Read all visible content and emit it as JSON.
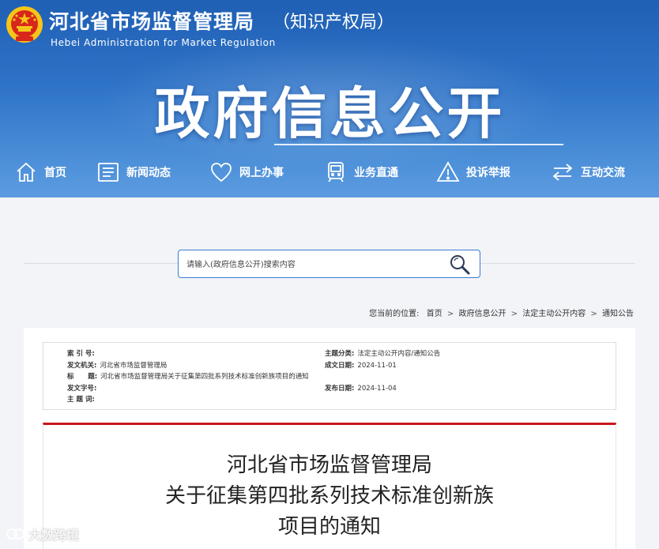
{
  "header": {
    "site_title": "河北省市场监督管理局",
    "site_suffix": "（知识产权局）",
    "site_en": "Hebei Administration  for  Market  Regulation",
    "banner_title": "政府信息公开"
  },
  "nav": {
    "items": [
      {
        "label": "首页",
        "icon": "home-icon"
      },
      {
        "label": "新闻动态",
        "icon": "news-icon"
      },
      {
        "label": "网上办事",
        "icon": "heart-icon"
      },
      {
        "label": "业务直通",
        "icon": "train-icon"
      },
      {
        "label": "投诉举报",
        "icon": "warning-icon"
      },
      {
        "label": "互动交流",
        "icon": "exchange-icon"
      }
    ]
  },
  "search": {
    "placeholder": "请输入(政府信息公开)搜索内容"
  },
  "breadcrumb": {
    "prefix": "您当前的位置:",
    "items": [
      "首页",
      "政府信息公开",
      "法定主动公开内容",
      "通知公告"
    ]
  },
  "meta": {
    "index_label": "索 引 号:",
    "index_value": "",
    "issuer_label": "发文机关:",
    "issuer_value": "河北省市场监督管理局",
    "title_label": "标      题:",
    "title_value": "河北省市场监督管理局关于征集第四批系列技术标准创新族项目的通知",
    "doc_no_label": "发文字号:",
    "doc_no_value": "",
    "subject_label": "主 题 词:",
    "subject_value": "",
    "category_label": "主题分类:",
    "category_value": "法定主动公开内容/通知公告",
    "created_label": "成文日期:",
    "created_value": "2024-11-01",
    "published_label": "发布日期:",
    "published_value": "2024-11-04"
  },
  "article": {
    "title_line1": "河北省市场监督管理局",
    "title_line2": "关于征集第四批系列技术标准创新族",
    "title_line3": "项目的通知"
  },
  "watermark": {
    "text": "大数跨境"
  },
  "colors": {
    "header_blue": "#2f74c8",
    "accent_red": "#c8161d",
    "search_border": "#3a7bd5"
  }
}
